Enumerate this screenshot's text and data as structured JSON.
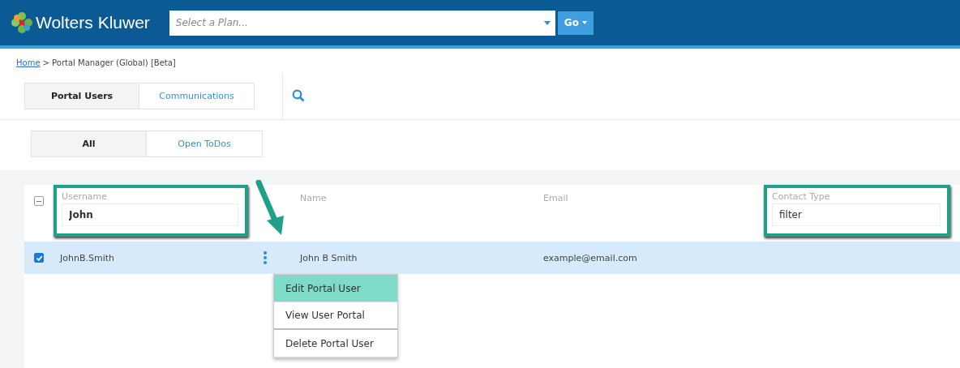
{
  "header": {
    "logo": "Wolters Kluwer",
    "plan_select": {
      "placeholder": "Select a Plan..."
    },
    "go_button": "Go"
  },
  "breadcrumb": [
    {
      "label": "Home",
      "kind": "link"
    },
    {
      "label": "> Portal Manager (Global) [Beta]",
      "kind": "text"
    }
  ],
  "tabs": [
    {
      "label": "Portal Users",
      "selected": true
    },
    {
      "label": "Communications",
      "selected": false
    }
  ],
  "filter_tabs": [
    {
      "label": "All",
      "selected": true
    },
    {
      "label": "Open ToDos",
      "selected": false
    }
  ],
  "table": {
    "select_all_partial": true,
    "columns": [
      {
        "label": "Username",
        "kind": "filter",
        "value": "John",
        "highlighted": true
      },
      {
        "label": "Name",
        "kind": "plain",
        "highlighted": false
      },
      {
        "label": "Email",
        "kind": "plain",
        "highlighted": false
      },
      {
        "label": "Contact Type",
        "kind": "filter",
        "value": "filter",
        "highlighted": true
      }
    ],
    "rows": [
      {
        "username": "JohnB.Smith",
        "name": "John B Smith",
        "email": "example@email.com",
        "checked": true,
        "selected": true
      }
    ]
  },
  "row_menu": {
    "items": [
      {
        "label": "Edit Portal User",
        "selected": true
      },
      {
        "label": "View User Portal",
        "selected": false
      },
      {
        "label": "Delete Portal User",
        "selected": false
      }
    ]
  }
}
